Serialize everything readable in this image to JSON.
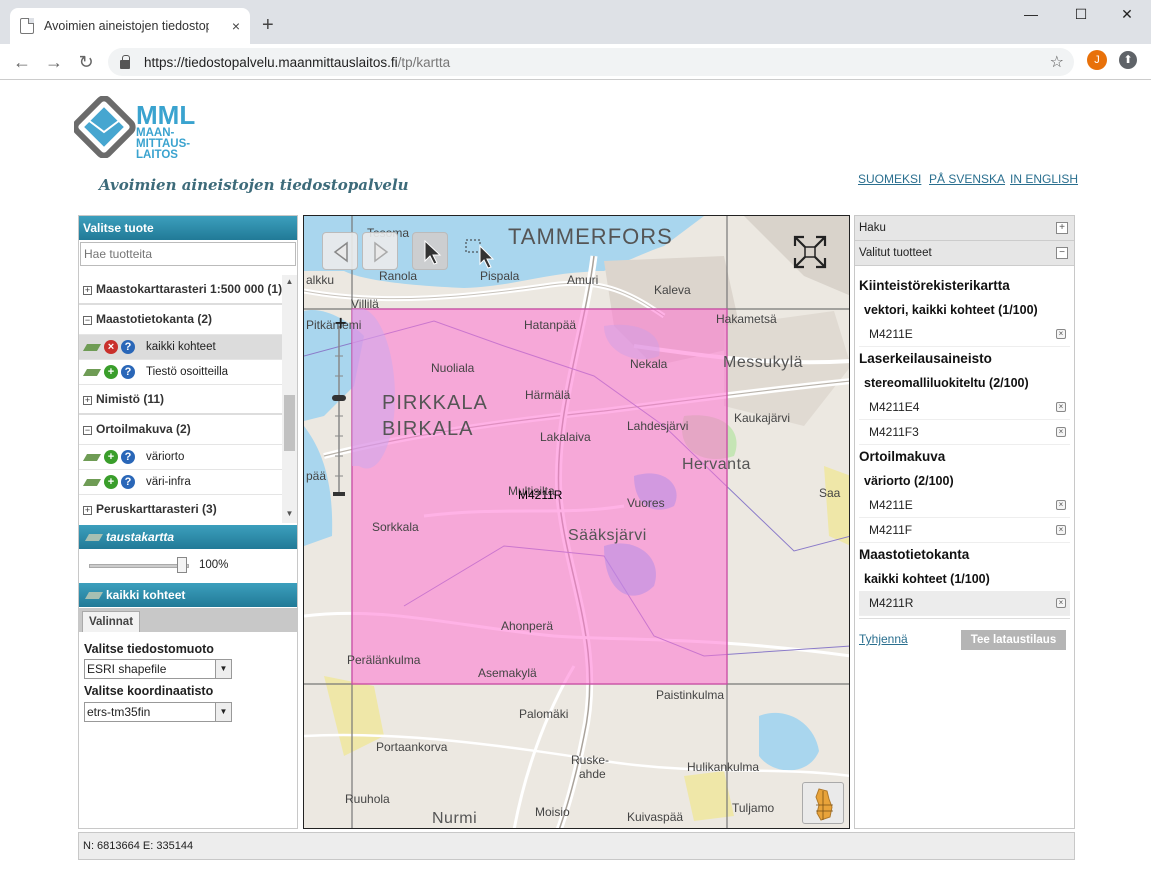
{
  "browser": {
    "tab_title": "Avoimien aineistojen tiedostopalvelu",
    "tab_close": "×",
    "new_tab": "+",
    "url_host": "https://tiedostopalvelu.maanmittauslaitos.fi",
    "url_path": "/tp/kartta",
    "avatar_letter": "J",
    "win_minimize": "—",
    "win_maximize": "☐",
    "win_close": "✕"
  },
  "header": {
    "logo_text_1": "MML",
    "logo_text_2": "MAAN-",
    "logo_text_3": "MITTAUS-",
    "logo_text_4": "LAITOS",
    "site_title": "Avoimien aineistojen tiedostopalvelu",
    "languages": [
      "SUOMEKSI",
      "PÅ SVENSKA",
      "IN ENGLISH"
    ]
  },
  "left_panel": {
    "title": "Valitse tuote",
    "search_placeholder": "Hae tuotteita",
    "tree": {
      "group_1": "Maastokarttarasteri 1:500 000 (1)",
      "group_2": "Maastotietokanta (2)",
      "item_2a": "kaikki kohteet",
      "item_2b": "Tiestö osoitteilla",
      "group_3": "Nimistö (11)",
      "group_4": "Ortoilmakuva (2)",
      "item_4a": "väriorto",
      "item_4b": "väri-infra",
      "group_5": "Peruskarttarasteri (3)"
    },
    "background_title": "taustakartta",
    "opacity_value": "100%",
    "opacity_level": 1.0,
    "layer_title": "kaikki kohteet",
    "tab_label": "Valinnat",
    "format_label": "Valitse tiedostomuoto",
    "format_value": "ESRI shapefile",
    "crs_label": "Valitse koordinaatisto",
    "crs_value": "etrs-tm35fin"
  },
  "map": {
    "labels": {
      "tammerfors": "TAMMERFORS",
      "tesoma": "Tesoma",
      "ranola": "Ranola",
      "pispala": "Pispala",
      "amuri": "Amuri",
      "kaleva": "Kaleva",
      "kalkku": "alkku",
      "villila": "Villilä",
      "pitkaniemi": "Pitkäniemi",
      "hatanpaa": "Hatanpää",
      "hakametsa": "Hakametsä",
      "nekala": "Nekala",
      "messukyla": "Messukylä",
      "nuoliala": "Nuoliala",
      "harmala": "Härmälä",
      "pirkkala": "PIRKKALA",
      "birkala": "BIRKALA",
      "lahdesjarvi": "Lahdesjärvi",
      "kaukajarvi": "Kaukajärvi",
      "lakalaiva": "Lakalaiva",
      "hervanta": "Hervanta",
      "paa": "pää",
      "multisilta": "Multisilta",
      "tile_label": "M4211R",
      "vuores": "Vuores",
      "saa": "Saa",
      "sorkkala": "Sorkkala",
      "saaksjarvi": "Sääksjärvi",
      "ahonpera": "Ahonperä",
      "peralankulma": "Perälänkulma",
      "asemakyla": "Asemakylä",
      "paistinkulma": "Paistinkulma",
      "palomaki": "Palomäki",
      "portaankorva": "Portaankorva",
      "ruskeahde_1": "Ruske-",
      "ruskeahde_2": "ahde",
      "hulikankulma": "Hulikankulma",
      "tuljamo": "Tuljamo",
      "ruuhola": "Ruuhola",
      "moisio": "Moisio",
      "kuivaspaa": "Kuivaspää",
      "nurmi": "Nurmi"
    },
    "icons": {
      "back": "back-arrow-icon",
      "forward": "forward-arrow-icon",
      "pointer": "pointer-icon",
      "select": "select-area-icon",
      "fullscreen": "fullscreen-icon",
      "overview": "finland-overview-icon"
    },
    "selection_color": "#ff73d2"
  },
  "right_panel": {
    "search_title": "Haku",
    "search_toggle": "+",
    "selected_title": "Valitut tuotteet",
    "selected_toggle": "−",
    "cat_1": "Kiinteistörekisterikartta",
    "subcat_1": "vektori, kaikki kohteet (1/100)",
    "prod_1a": "M4211E",
    "cat_2": "Laserkeilausaineisto",
    "subcat_2": "stereomalliluokiteltu (2/100)",
    "prod_2a": "M4211E4",
    "prod_2b": "M4211F3",
    "cat_3": "Ortoilmakuva",
    "subcat_3": "väriorto (2/100)",
    "prod_3a": "M4211E",
    "prod_3b": "M4211F",
    "cat_4": "Maastotietokanta",
    "subcat_4": "kaikki kohteet (1/100)",
    "prod_4a": "M4211R",
    "remove_glyph": "×",
    "clear_label": "Tyhjennä",
    "order_label": "Tee lataustilaus"
  },
  "status": {
    "coords": "N: 6813664 E: 335144"
  }
}
